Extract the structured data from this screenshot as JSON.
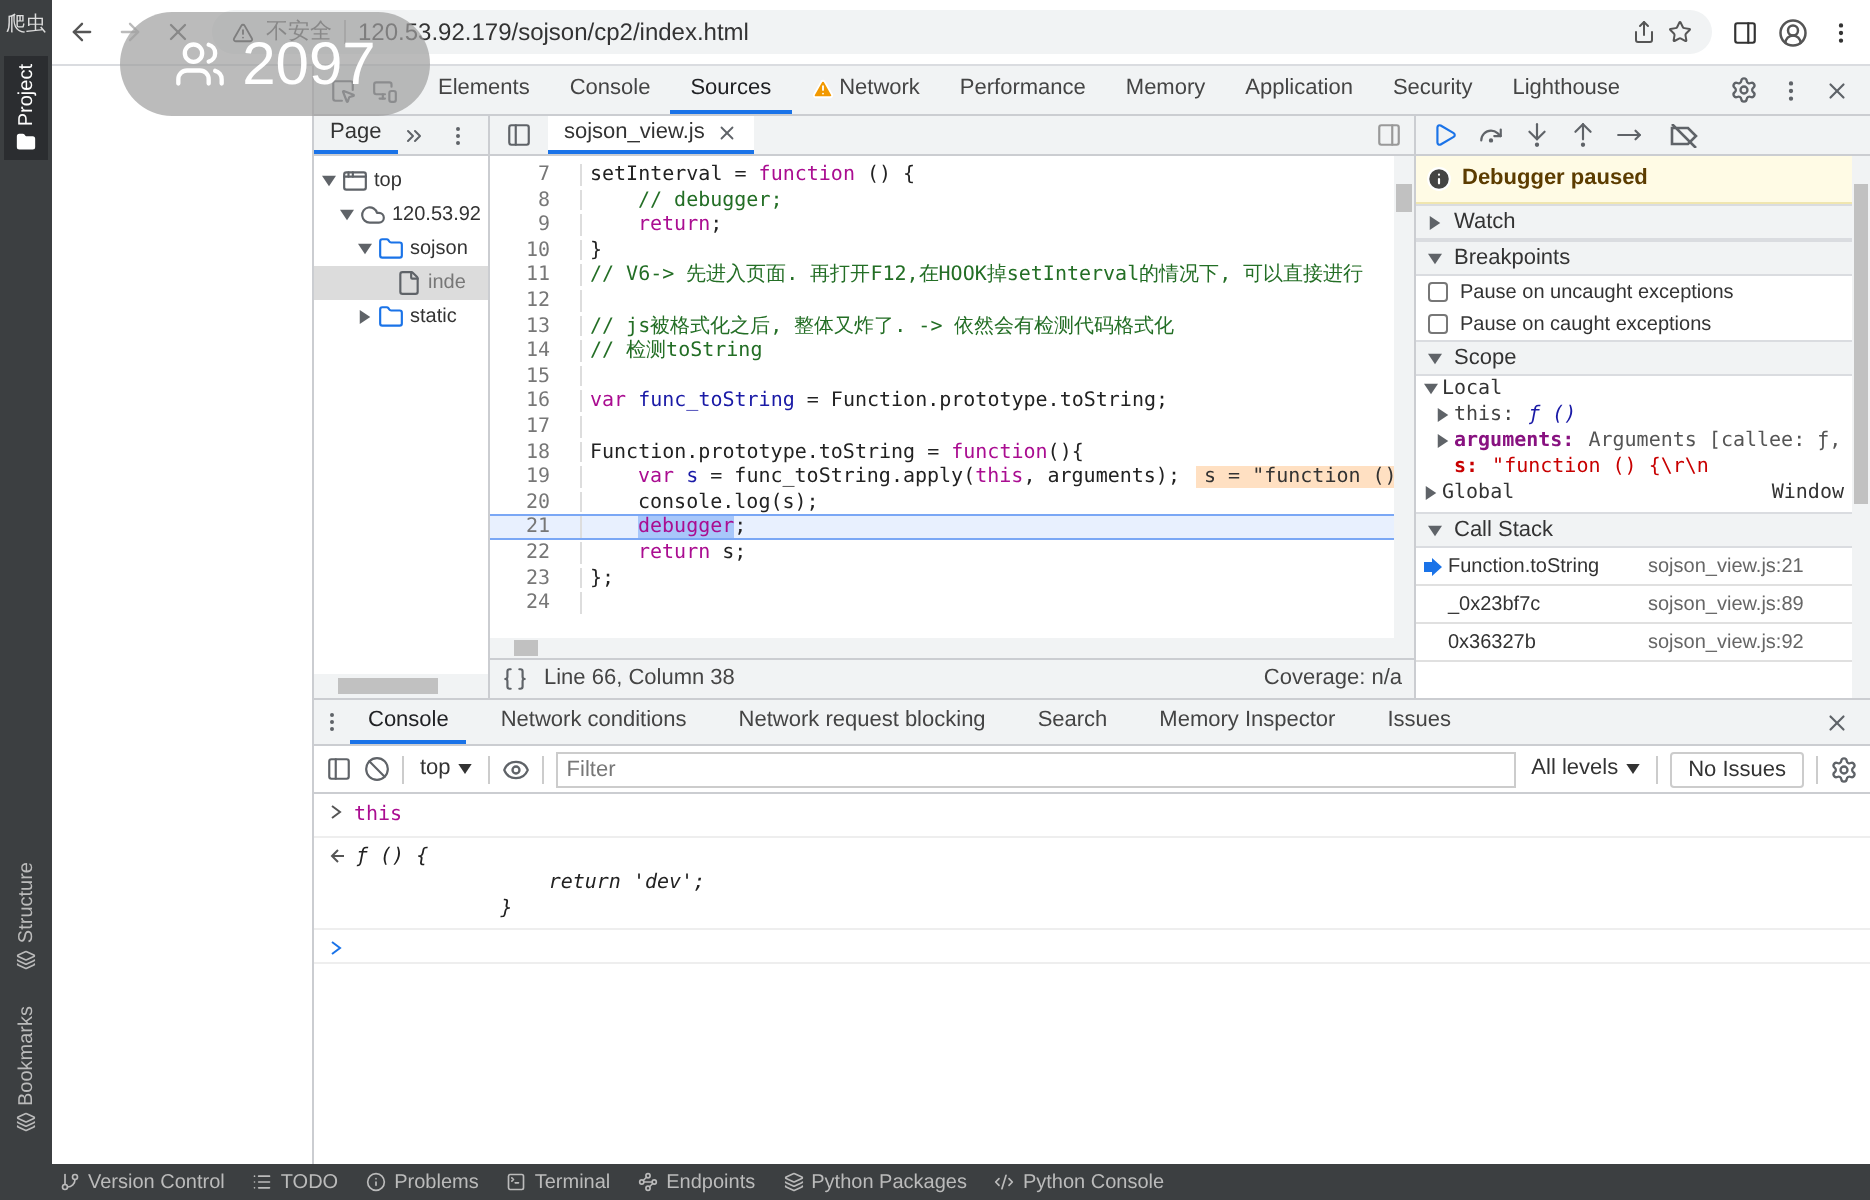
{
  "ide": {
    "project_title": "爬虫",
    "top_side_tabs": [
      {
        "label": "Project",
        "selected": true
      }
    ],
    "bottom_side_tabs": [
      {
        "label": "Structure",
        "selected": false
      },
      {
        "label": "Bookmarks",
        "selected": false
      }
    ],
    "bottom_tabs": [
      "Version Control",
      "TODO",
      "Problems",
      "Terminal",
      "Endpoints",
      "Python Packages",
      "Python Console"
    ]
  },
  "overlay": {
    "count": "2097"
  },
  "browser": {
    "security_label": "不安全",
    "url": "120.53.92.179/sojson/cp2/index.html",
    "loading": true
  },
  "devtools": {
    "tabs": [
      {
        "label": "Elements",
        "selected": false,
        "warning": false
      },
      {
        "label": "Console",
        "selected": false,
        "warning": false
      },
      {
        "label": "Sources",
        "selected": true,
        "warning": false
      },
      {
        "label": "Network",
        "selected": false,
        "warning": true
      },
      {
        "label": "Performance",
        "selected": false,
        "warning": false
      },
      {
        "label": "Memory",
        "selected": false,
        "warning": false
      },
      {
        "label": "Application",
        "selected": false,
        "warning": false
      },
      {
        "label": "Security",
        "selected": false,
        "warning": false
      },
      {
        "label": "Lighthouse",
        "selected": false,
        "warning": false
      }
    ],
    "navigator": {
      "tab": "Page",
      "tree": [
        {
          "label": "top",
          "kind": "frame",
          "expanded": true,
          "selected": false,
          "children": [
            {
              "label": "120.53.92",
              "kind": "domain",
              "expanded": true,
              "selected": false,
              "children": [
                {
                  "label": "sojson",
                  "kind": "folder",
                  "expanded": true,
                  "selected": false,
                  "children": [
                    {
                      "label": "inde",
                      "kind": "file",
                      "selected": true
                    }
                  ]
                },
                {
                  "label": "static",
                  "kind": "folder",
                  "expanded": false,
                  "selected": false
                }
              ]
            }
          ]
        }
      ]
    },
    "editor": {
      "file_tab": "sojson_view.js",
      "position": "Line 66, Column 38",
      "coverage": "Coverage: n/a",
      "lines": [
        {
          "number": "7",
          "current": false,
          "tokens": [
            {
              "kind": "plain",
              "text": "setInterval = "
            },
            {
              "kind": "keyword",
              "text": "function"
            },
            {
              "kind": "plain",
              "text": " () {"
            }
          ]
        },
        {
          "number": "8",
          "current": false,
          "indented": true,
          "tokens": [
            {
              "kind": "comment",
              "text": "// debugger;"
            }
          ]
        },
        {
          "number": "9",
          "current": false,
          "indented": true,
          "tokens": [
            {
              "kind": "keyword",
              "text": "return"
            },
            {
              "kind": "plain",
              "text": ";"
            }
          ]
        },
        {
          "number": "10",
          "current": false,
          "tokens": [
            {
              "kind": "plain",
              "text": "}"
            }
          ]
        },
        {
          "number": "11",
          "current": false,
          "tokens": [
            {
              "kind": "comment",
              "text": "// V6-> 先进入页面. 再打开F12,在HOOK掉setInterval的情况下, 可以直接进行"
            }
          ]
        },
        {
          "number": "12",
          "current": false
        },
        {
          "number": "13",
          "current": false,
          "tokens": [
            {
              "kind": "comment",
              "text": "// js被格式化之后, 整体又炸了. -> 依然会有检测代码格式化"
            }
          ]
        },
        {
          "number": "14",
          "current": false,
          "tokens": [
            {
              "kind": "comment",
              "text": "// 检测toString"
            }
          ]
        },
        {
          "number": "15",
          "current": false
        },
        {
          "number": "16",
          "current": false,
          "tokens": [
            {
              "kind": "keyword",
              "text": "var "
            },
            {
              "kind": "variable",
              "text": "func_toString"
            },
            {
              "kind": "plain",
              "text": " = Function.prototype.toString;"
            }
          ]
        },
        {
          "number": "17",
          "current": false
        },
        {
          "number": "18",
          "current": false,
          "tokens": [
            {
              "kind": "plain",
              "text": "Function.prototype.toString = "
            },
            {
              "kind": "keyword",
              "text": "function"
            },
            {
              "kind": "plain",
              "text": "(){"
            }
          ]
        },
        {
          "number": "19",
          "current": false,
          "indented": true,
          "inline_value": "s = \"function ()",
          "tokens": [
            {
              "kind": "keyword",
              "text": "var "
            },
            {
              "kind": "variable",
              "text": "s"
            },
            {
              "kind": "plain",
              "text": " = func_toString.apply("
            },
            {
              "kind": "keyword",
              "text": "this"
            },
            {
              "kind": "plain",
              "text": ", arguments);"
            }
          ]
        },
        {
          "number": "20",
          "current": false,
          "indented": true,
          "tokens": [
            {
              "kind": "plain",
              "text": "console.log(s);"
            }
          ]
        },
        {
          "number": "21",
          "current": true,
          "indented": true,
          "tokens": [
            {
              "kind": "highlight",
              "text": "debugger"
            },
            {
              "kind": "plain",
              "text": ";"
            }
          ]
        },
        {
          "number": "22",
          "current": false,
          "indented": true,
          "tokens": [
            {
              "kind": "keyword",
              "text": "return"
            },
            {
              "kind": "plain",
              "text": " s;"
            }
          ]
        },
        {
          "number": "23",
          "current": false,
          "tokens": [
            {
              "kind": "plain",
              "text": "};"
            }
          ]
        },
        {
          "number": "24",
          "current": false
        }
      ]
    },
    "debugger": {
      "status": "Debugger paused",
      "watch": {
        "title": "Watch",
        "expanded": false
      },
      "breakpoints": {
        "title": "Breakpoints",
        "expanded": true,
        "options": [
          {
            "label": "Pause on uncaught exceptions",
            "checked": false
          },
          {
            "label": "Pause on caught exceptions",
            "checked": false
          }
        ]
      },
      "scope": {
        "title": "Scope",
        "expanded": true,
        "items": [
          {
            "name": "Local",
            "expanded": true,
            "children": [
              {
                "name": "this:",
                "kind": "plain",
                "value": "ƒ ()",
                "expanded": false
              },
              {
                "name": "arguments:",
                "kind": "own",
                "value": "Arguments [callee: ƒ,",
                "expanded": false
              },
              {
                "name": "s:",
                "kind": "string",
                "value": "\"function () {\\r\\n"
              }
            ]
          },
          {
            "name": "Global",
            "value": "Window",
            "expanded": false
          }
        ]
      },
      "call_stack": {
        "title": "Call Stack",
        "expanded": true,
        "frames": [
          {
            "name": "Function.toString",
            "location": "sojson_view.js:21",
            "selected": true
          },
          {
            "name": "_0x23bf7c",
            "location": "sojson_view.js:89",
            "selected": false
          },
          {
            "name": "0x36327b",
            "location": "sojson_view.js:92",
            "selected": false
          }
        ]
      }
    }
  },
  "drawer": {
    "tabs": [
      {
        "label": "Console",
        "selected": true
      },
      {
        "label": "Network conditions",
        "selected": false
      },
      {
        "label": "Network request blocking",
        "selected": false
      },
      {
        "label": "Search",
        "selected": false
      },
      {
        "label": "Memory Inspector",
        "selected": false
      },
      {
        "label": "Issues",
        "selected": false
      }
    ],
    "context": "top",
    "filter_placeholder": "Filter",
    "levels": "All levels",
    "issues": "No Issues",
    "entries": [
      {
        "kind": "input",
        "text": "this"
      },
      {
        "kind": "output",
        "text": "ƒ () {\n                return 'dev';\n            }"
      },
      {
        "kind": "prompt"
      }
    ]
  }
}
